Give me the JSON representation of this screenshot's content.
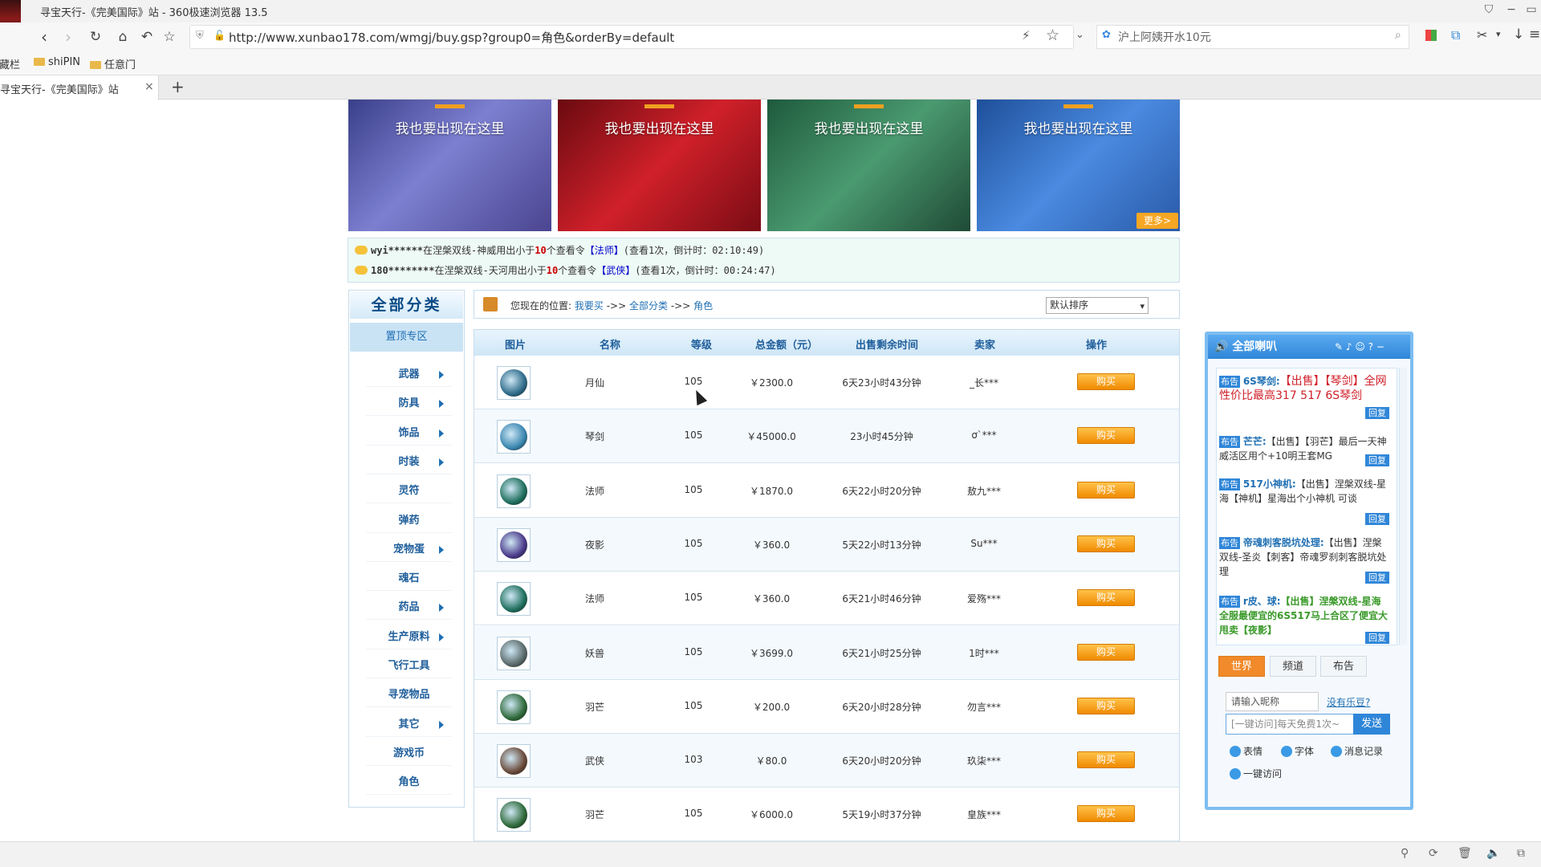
{
  "window": {
    "title": "寻宝天行-《完美国际》站 - 360极速浏览器 13.5"
  },
  "nav": {
    "url": "http://www.xunbao178.com/wmgj/buy.gsp?group0=角色&orderBy=default",
    "search_placeholder": "沪上阿姨开水10元"
  },
  "bookmarks": [
    {
      "label": "收藏栏"
    },
    {
      "label": "shiPIN"
    },
    {
      "label": "任意门"
    }
  ],
  "tab": {
    "title": "寻宝天行-《完美国际》站",
    "close": "×",
    "new": "+"
  },
  "banners": [
    {
      "text": "我也要出现在这里",
      "color": "#6b6fc4"
    },
    {
      "text": "我也要出现在这里",
      "color": "#b4161e"
    },
    {
      "text": "我也要出现在这里",
      "color": "#2f7a55"
    },
    {
      "text": "我也要出现在这里",
      "color": "#2a6fc4"
    }
  ],
  "banner_more": "更多>",
  "ticker": [
    {
      "user": "wyi******",
      "mid": "在涅槃双线-神威用出小于",
      "num": "10",
      "mid2": "个查看令",
      "cls": "【法师】",
      "rest": "(查看1次，倒计时：02:10:49)"
    },
    {
      "user": "180********",
      "mid": "在涅槃双线-天河用出小于",
      "num": "10",
      "mid2": "个查看令",
      "cls": "【武侠】",
      "rest": "(查看1次，倒计时：00:24:47)"
    }
  ],
  "sidebar": {
    "title": "全部分类",
    "top_item": "置顶专区",
    "items": [
      {
        "label": "武器",
        "arrow": true
      },
      {
        "label": "防具",
        "arrow": true
      },
      {
        "label": "饰品",
        "arrow": true
      },
      {
        "label": "时装",
        "arrow": true
      },
      {
        "label": "灵符",
        "arrow": false
      },
      {
        "label": "弹药",
        "arrow": false
      },
      {
        "label": "宠物蛋",
        "arrow": true
      },
      {
        "label": "魂石",
        "arrow": false
      },
      {
        "label": "药品",
        "arrow": true
      },
      {
        "label": "生产原料",
        "arrow": true
      },
      {
        "label": "飞行工具",
        "arrow": false
      },
      {
        "label": "寻宠物品",
        "arrow": false
      },
      {
        "label": "其它",
        "arrow": true
      },
      {
        "label": "游戏币",
        "arrow": false
      },
      {
        "label": "角色",
        "arrow": false
      }
    ]
  },
  "breadcrumb": {
    "prefix": "您现在的位置:",
    "c1": "我要买",
    "sep": "->>",
    "c2": "全部分类",
    "c3": "角色"
  },
  "sort": {
    "selected": "默认排序"
  },
  "table": {
    "headers": [
      "图片",
      "名称",
      "等级",
      "总金额（元）",
      "出售剩余时间",
      "卖家",
      "操作"
    ],
    "buy_label": "购买",
    "rows": [
      {
        "name": "月仙",
        "level": "105",
        "price": "￥2300.0",
        "time": "6天23小时43分钟",
        "seller": "_长***",
        "icon": "#2e6b8a"
      },
      {
        "name": "琴剑",
        "level": "105",
        "price": "￥45000.0",
        "time": "23小时45分钟",
        "seller": "ơ`***",
        "icon": "#3a86b0"
      },
      {
        "name": "法师",
        "level": "105",
        "price": "￥1870.0",
        "time": "6天22小时20分钟",
        "seller": "敖九***",
        "icon": "#1f6f5e"
      },
      {
        "name": "夜影",
        "level": "105",
        "price": "￥360.0",
        "time": "5天22小时13分钟",
        "seller": "Su***",
        "icon": "#4a3a8a"
      },
      {
        "name": "法师",
        "level": "105",
        "price": "￥360.0",
        "time": "6天21小时46分钟",
        "seller": "爱殇***",
        "icon": "#1f6f5e"
      },
      {
        "name": "妖兽",
        "level": "105",
        "price": "￥3699.0",
        "time": "6天21小时25分钟",
        "seller": "1时***",
        "icon": "#5a6a6a"
      },
      {
        "name": "羽芒",
        "level": "105",
        "price": "￥200.0",
        "time": "6天20小时28分钟",
        "seller": "勿言***",
        "icon": "#2f6a3a"
      },
      {
        "name": "武侠",
        "level": "103",
        "price": "￥80.0",
        "time": "6天20小时20分钟",
        "seller": "玖柒***",
        "icon": "#6a4a3a"
      },
      {
        "name": "羽芒",
        "level": "105",
        "price": "￥6000.0",
        "time": "5天19小时37分钟",
        "seller": "皇族***",
        "icon": "#2f6a3a"
      }
    ]
  },
  "chat": {
    "title": "全部喇叭",
    "tag": "布告",
    "reply": "回复",
    "messages": [
      {
        "user": "6S琴剑:",
        "text": "【出售】【琴剑】全网性价比最高317 517 6S琴剑"
      },
      {
        "user": "芒芒:",
        "text": "【出售】【羽芒】最后一天神威活区用个+10明王套MG"
      },
      {
        "user": "517小神机:",
        "text": "【出售】涅槃双线-星海【神机】星海出个小神机 可谈"
      },
      {
        "user": "帝魂刺客脱坑处理:",
        "text": "【出售】涅槃双线-圣炎【刺客】帝魂罗刹刺客脱坑处理"
      },
      {
        "user": "r皮、球:",
        "text": "【出售】涅槃双线-星海全服最便宜的6S517马上合区了便宜大甩卖【夜影】"
      }
    ],
    "tabs": [
      "世界",
      "频道",
      "布告"
    ],
    "nick_placeholder": "请输入昵称",
    "no_music": "没有乐豆?",
    "msg_placeholder": "[一键访问]每天免费1次~",
    "send": "发送",
    "tools": [
      "表情",
      "字体",
      "消息记录",
      "一键访问"
    ]
  }
}
